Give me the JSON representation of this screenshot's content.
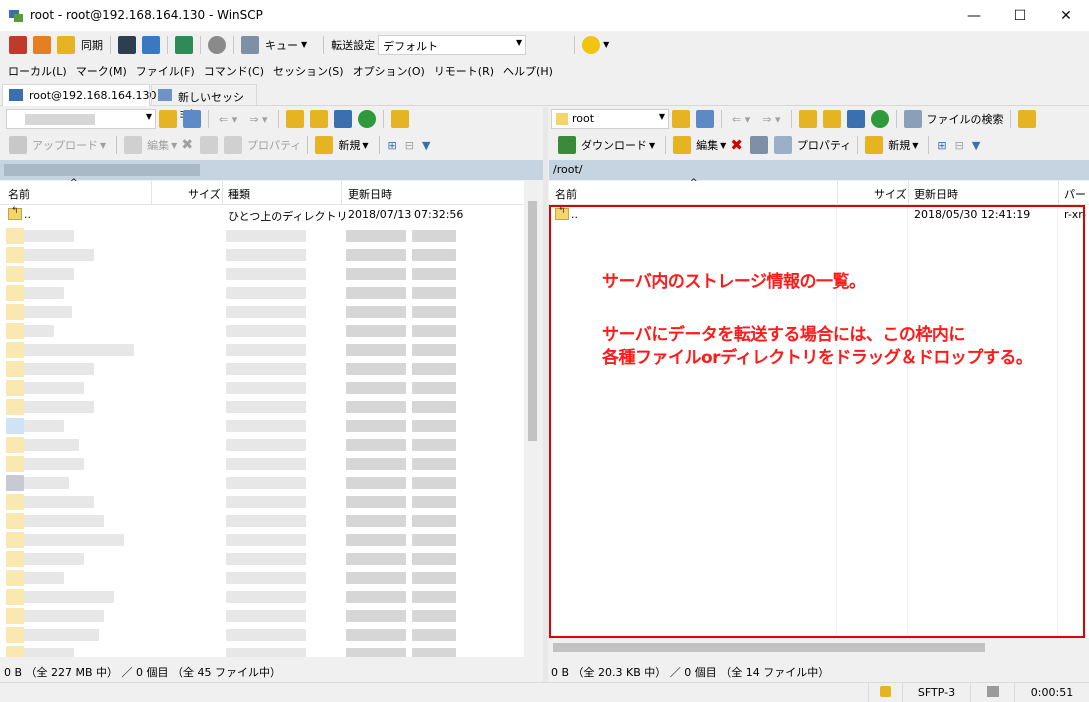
{
  "window": {
    "title": "root - root@192.168.164.130 - WinSCP",
    "minimize": "—",
    "maximize": "☐",
    "close": "✕"
  },
  "toolbar": {
    "sync_label": "同期",
    "queue_label": "キュー",
    "transfer_settings_label": "転送設定",
    "transfer_preset": "デフォルト"
  },
  "menu": [
    "ローカル(L)",
    "マーク(M)",
    "ファイル(F)",
    "コマンド(C)",
    "セッション(S)",
    "オプション(O)",
    "リモート(R)",
    "ヘルプ(H)"
  ],
  "tabs": {
    "session": "root@192.168.164.130",
    "new_session": "新しいセッション"
  },
  "left": {
    "upload": "アップロード",
    "edit": "編集",
    "properties": "プロパティ",
    "new": "新規",
    "columns": [
      "名前",
      "サイズ",
      "種類",
      "更新日時"
    ],
    "parent_row": {
      "name": "..",
      "type": "ひとつ上のディレクトリ",
      "date": "2018/07/13",
      "time": "07:32:56"
    },
    "status": "0 B （全 227 MB 中） ／ 0 個目 （全 45 ファイル中）"
  },
  "right": {
    "path_combo": "root",
    "find_files": "ファイルの検索",
    "download": "ダウンロード",
    "edit": "編集",
    "properties": "プロパティ",
    "new": "新規",
    "path": "/root/",
    "columns": [
      "名前",
      "サイズ",
      "更新日時",
      "パーミ"
    ],
    "parent_row": {
      "name": "..",
      "date": "2018/05/30 12:41:19",
      "perm": "r-xr-"
    },
    "status": "0 B （全 20.3 KB 中） ／ 0 個目 （全 14 ファイル中）"
  },
  "annotation": {
    "line1": "サーバ内のストレージ情報の一覧。",
    "line2": "サーバにデータを転送する場合には、この枠内に",
    "line3": "各種ファイルorディレクトリをドラッグ＆ドロップする。"
  },
  "statusbar": {
    "protocol": "SFTP-3",
    "elapsed": "0:00:51"
  },
  "colors": {
    "path_bar": "#c5d4e0",
    "annotation": "#ff1a1a",
    "highlight_box": "#e00000"
  }
}
